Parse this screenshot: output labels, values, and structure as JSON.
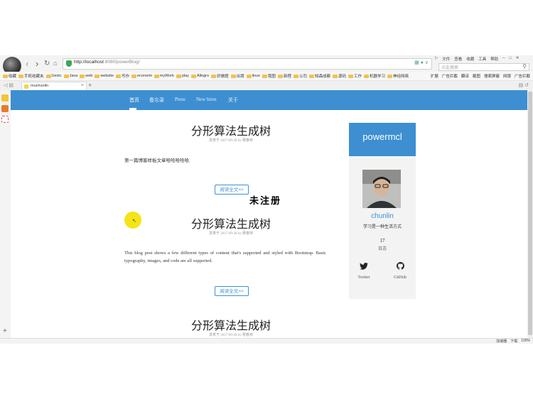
{
  "browser": {
    "url_host": "http://localhost",
    "url_path": ":8080/powerBlog/",
    "search_placeholder": "点此搜索",
    "menu": [
      "文件",
      "查看",
      "收藏",
      "工具",
      "帮助"
    ],
    "bookmarks": [
      "收藏",
      "手机收藏夹",
      "Uestc",
      "Java",
      "web",
      "website",
      "写作",
      "economi",
      "myWork",
      "play",
      "Allegro",
      "好做题",
      "出境",
      "linux",
      "我图",
      "新程",
      "公司",
      "知森成都",
      "源码",
      "工作",
      "机器学习",
      "神经网络"
    ],
    "bookmarks_right": [
      "扩展",
      "广告拦截",
      "翻译",
      "截图",
      "搜索屏蔽",
      "网银",
      "广告拦截"
    ],
    "tab_title": "muchunlin",
    "status_items": [
      "加速器",
      "下载",
      "100%"
    ],
    "accent": "#3d8fd1"
  },
  "nav": {
    "items": [
      "首页",
      "备忘录",
      "Press",
      "New hires",
      "关于"
    ]
  },
  "posts": [
    {
      "title": "分形算法生成树",
      "meta": "发表于 2017-09-28 by 穆春林",
      "body": "第一篇博客样板文章哈哈哈哈哈.",
      "readmore": "阅读全文>>"
    },
    {
      "title": "分形算法生成树",
      "meta": "发表于 2017-09-28 by 穆春林",
      "body": "This blog post shows a few different types of content that's supported and styled with Bootstrap. Basic typography, images, and code are all supported.",
      "readmore": "阅读全文>>"
    },
    {
      "title": "分形算法生成树",
      "meta": "发表于 2017-09-28 by 穆春林"
    }
  ],
  "sidebar": {
    "brand": "powermcl",
    "name": "chunlin",
    "bio": "学习是一种生活方式",
    "count": "17",
    "count_label": "日志",
    "social": [
      {
        "label": "Twitter",
        "icon": "twitter-icon"
      },
      {
        "label": "GitHub",
        "icon": "github-icon"
      }
    ]
  },
  "watermark": "未注册"
}
